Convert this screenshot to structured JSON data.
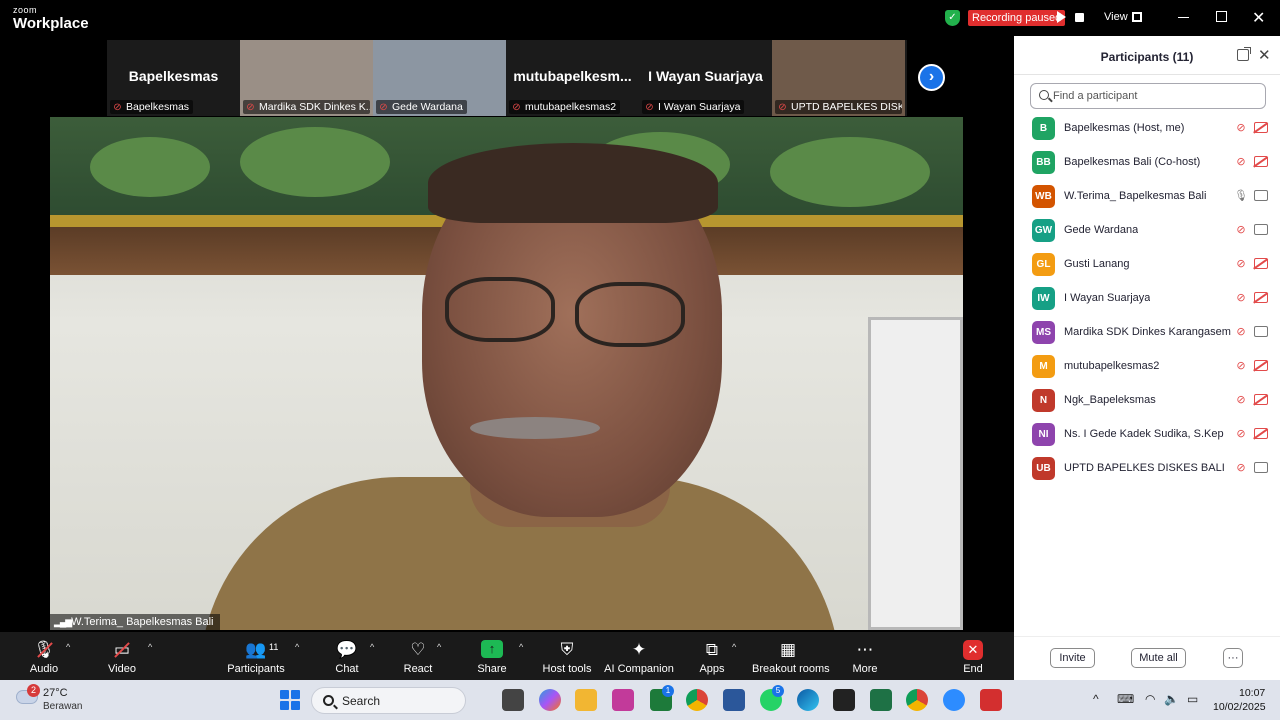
{
  "titlebar": {
    "brand_small": "zoom",
    "brand_big": "Workplace",
    "recording_status": "Recording paused",
    "view_label": "View"
  },
  "thumbnails": [
    {
      "big_name": "Bapelkesmas",
      "label": "Bapelkesmas",
      "bg": "#1b1b1b"
    },
    {
      "big_name": "",
      "label": "Mardika SDK Dinkes K...",
      "bg": "#9a8f86"
    },
    {
      "big_name": "",
      "label": "Gede Wardana",
      "bg": "#8c96a2"
    },
    {
      "big_name": "mutubapelkesm...",
      "label": "mutubapelkesmas2",
      "bg": "#1b1b1b"
    },
    {
      "big_name": "I Wayan Suarjaya",
      "label": "I Wayan Suarjaya",
      "bg": "#1b1b1b"
    },
    {
      "big_name": "",
      "label": "UPTD BAPELKES DISKE...",
      "bg": "#6f5a4a"
    }
  ],
  "main_video": {
    "label": "W.Terima_ Bapelkesmas Bali"
  },
  "panel": {
    "title": "Participants (11)",
    "search_placeholder": "Find a participant",
    "participants": [
      {
        "initials": "B",
        "name": "Bapelkesmas (Host, me)",
        "color": "#1fa463",
        "mic": "muted",
        "cam": "off"
      },
      {
        "initials": "BB",
        "name": "Bapelkesmas Bali (Co-host)",
        "color": "#1fa463",
        "mic": "muted",
        "cam": "off"
      },
      {
        "initials": "WB",
        "name": "W.Terima_ Bapelkesmas Bali",
        "color": "#d35400",
        "mic": "on",
        "cam": "on"
      },
      {
        "initials": "GW",
        "name": "Gede Wardana",
        "color": "#16a085",
        "mic": "muted",
        "cam": "on"
      },
      {
        "initials": "GL",
        "name": "Gusti Lanang",
        "color": "#f39c12",
        "mic": "muted",
        "cam": "off"
      },
      {
        "initials": "IW",
        "name": "I Wayan Suarjaya",
        "color": "#16a085",
        "mic": "muted",
        "cam": "off"
      },
      {
        "initials": "MS",
        "name": "Mardika SDK Dinkes Karangasem",
        "color": "#8e44ad",
        "mic": "muted",
        "cam": "on"
      },
      {
        "initials": "M",
        "name": "mutubapelkesmas2",
        "color": "#f39c12",
        "mic": "muted",
        "cam": "off"
      },
      {
        "initials": "N",
        "name": "Ngk_Bapeleksmas",
        "color": "#c0392b",
        "mic": "muted",
        "cam": "off"
      },
      {
        "initials": "NI",
        "name": "Ns. I Gede Kadek Sudika, S.Kep",
        "color": "#8e44ad",
        "mic": "muted",
        "cam": "off"
      },
      {
        "initials": "UB",
        "name": "UPTD BAPELKES DISKES BALI",
        "color": "#c0392b",
        "mic": "muted",
        "cam": "on"
      }
    ],
    "invite_label": "Invite",
    "mute_all_label": "Mute all",
    "more_label": "···"
  },
  "toolbar": {
    "audio": "Audio",
    "video": "Video",
    "participants": "Participants",
    "participants_count": "11",
    "chat": "Chat",
    "react": "React",
    "share": "Share",
    "host_tools": "Host tools",
    "ai_companion": "AI Companion",
    "apps": "Apps",
    "breakout_rooms": "Breakout rooms",
    "more": "More",
    "end": "End"
  },
  "taskbar": {
    "weather_badge": "2",
    "temperature": "27°C",
    "weather": "Berawan",
    "search_label": "Search",
    "time": "10:07",
    "date": "10/02/2025",
    "whatsapp_badge": "5",
    "phone_badge": "1"
  }
}
